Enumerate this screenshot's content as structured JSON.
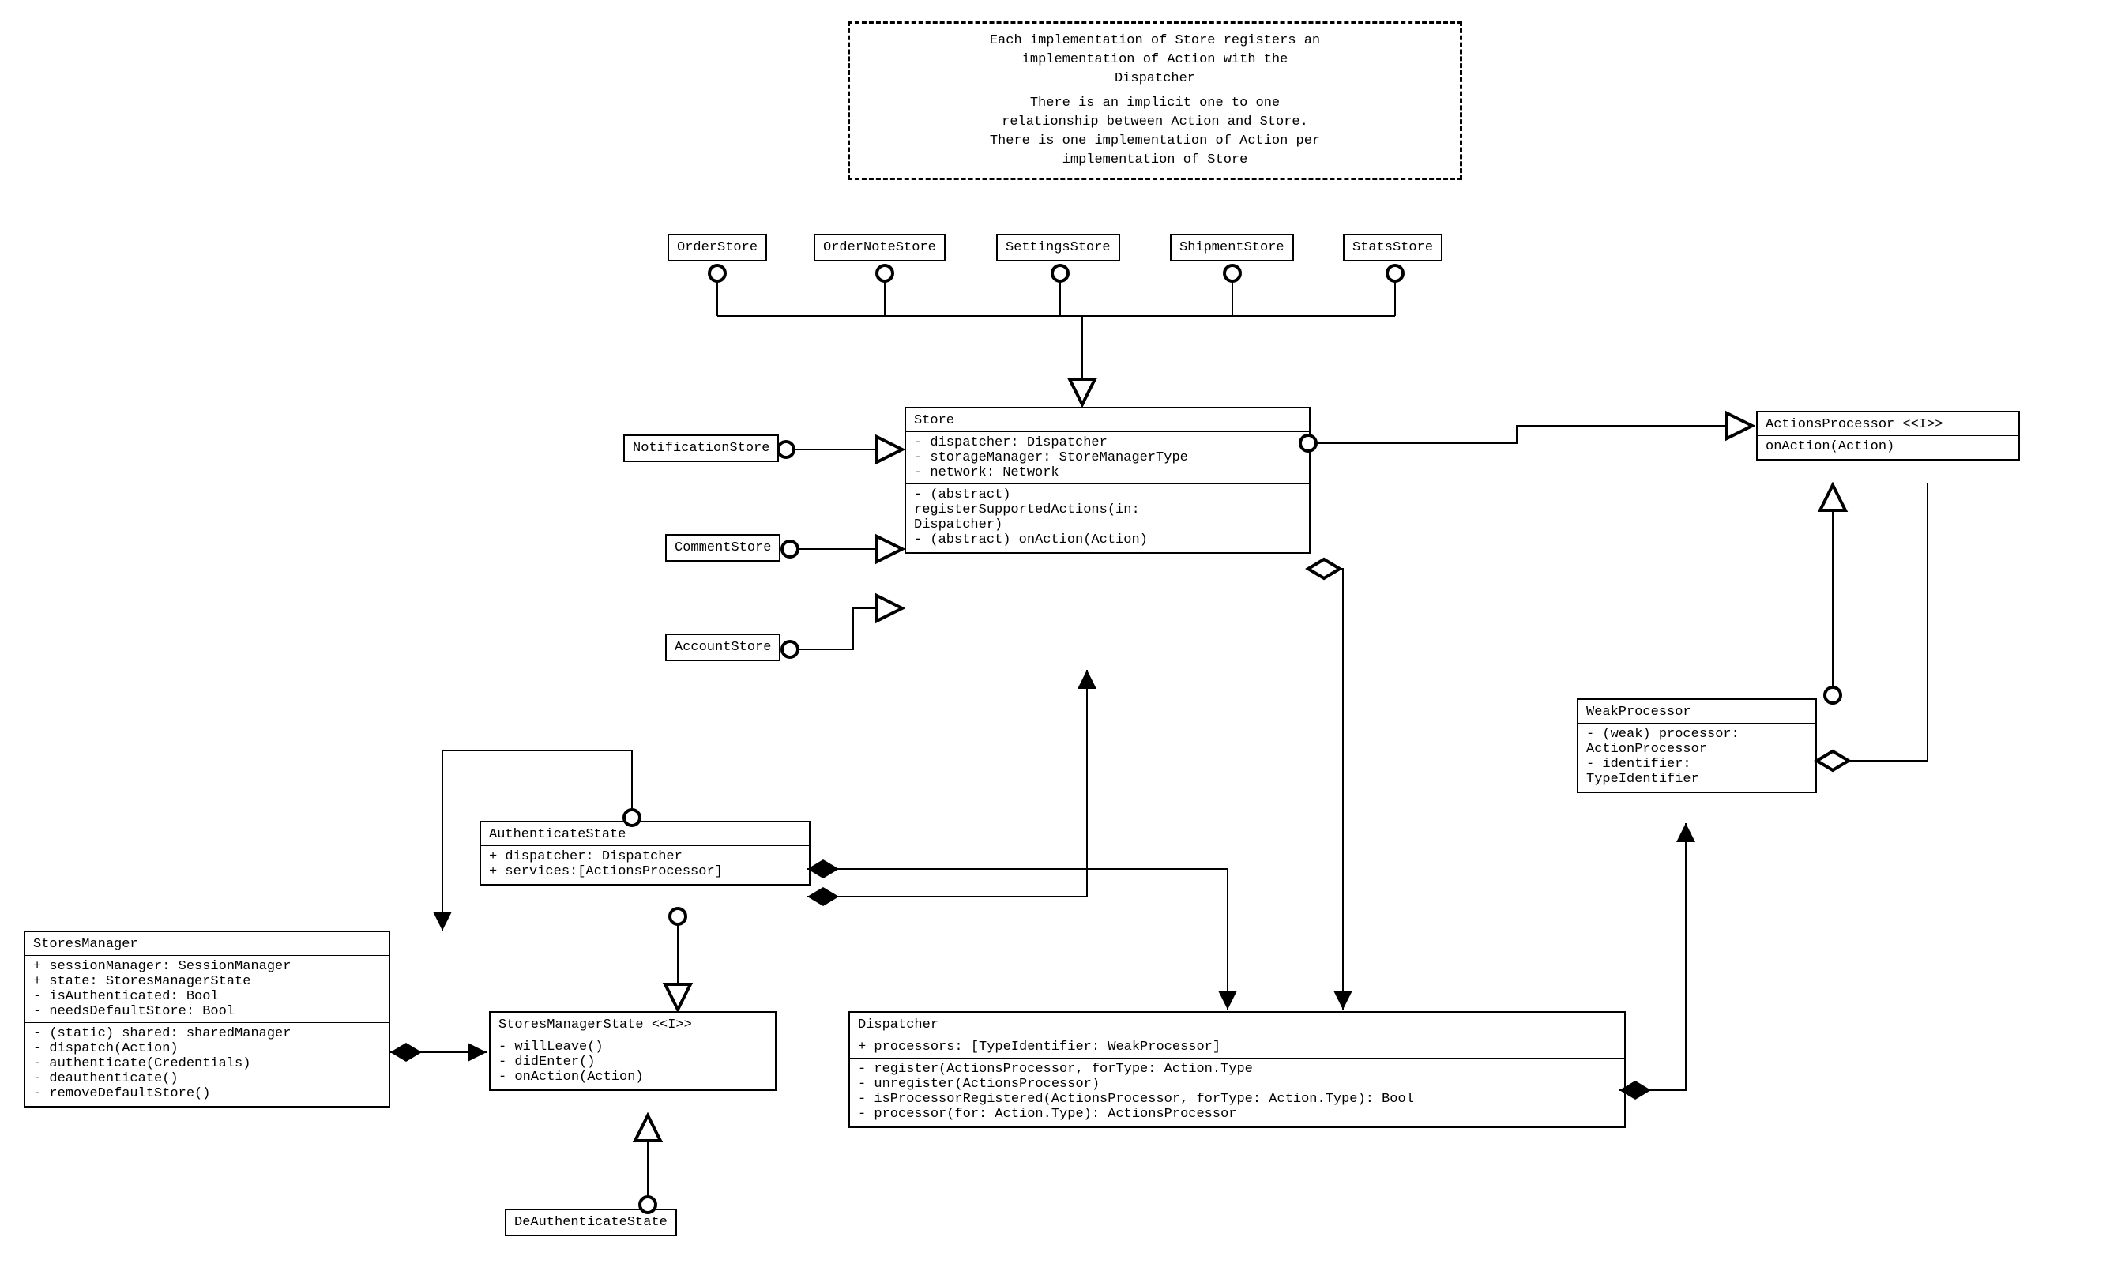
{
  "note": {
    "p1": "Each implementation of Store registers an",
    "p2": "implementation of Action with the",
    "p3": "Dispatcher",
    "p4": "There is an implicit one to one",
    "p5": "relationship between Action and Store.",
    "p6": "There is one implementation of Action per",
    "p7": "implementation of Store"
  },
  "topStores": {
    "orderStore": "OrderStore",
    "orderNoteStore": "OrderNoteStore",
    "settingsStore": "SettingsStore",
    "shipmentStore": "ShipmentStore",
    "statsStore": "StatsStore"
  },
  "leftStores": {
    "notificationStore": "NotificationStore",
    "commentStore": "CommentStore",
    "accountStore": "AccountStore"
  },
  "store": {
    "title": "Store",
    "f1": "- dispatcher: Dispatcher",
    "f2": "- storageManager: StoreManagerType",
    "f3": "- network: Network",
    "m1": "- (abstract)",
    "m2": "registerSupportedActions(in:",
    "m3": "Dispatcher)",
    "m4": "- (abstract) onAction(Action)"
  },
  "actionsProcessor": {
    "title": "ActionsProcessor <<I>>",
    "m1": "onAction(Action)"
  },
  "weakProcessor": {
    "title": "WeakProcessor",
    "f1": "- (weak) processor:",
    "f2": "ActionProcessor",
    "f3": "- identifier:",
    "f4": "TypeIdentifier"
  },
  "authState": {
    "title": "AuthenticateState",
    "f1": "+ dispatcher: Dispatcher",
    "f2": "+ services:[ActionsProcessor]"
  },
  "storesManager": {
    "title": "StoresManager",
    "f1": "+ sessionManager: SessionManager",
    "f2": "+ state: StoresManagerState",
    "f3": "- isAuthenticated: Bool",
    "f4": "- needsDefaultStore: Bool",
    "m1": "- (static) shared: sharedManager",
    "m2": "- dispatch(Action)",
    "m3": "- authenticate(Credentials)",
    "m4": "- deauthenticate()",
    "m5": "- removeDefaultStore()"
  },
  "storesManagerState": {
    "title": "StoresManagerState <<I>>",
    "m1": "- willLeave()",
    "m2": "- didEnter()",
    "m3": "- onAction(Action)"
  },
  "dispatcher": {
    "title": "Dispatcher",
    "f1": "+ processors: [TypeIdentifier: WeakProcessor]",
    "m1": "- register(ActionsProcessor, forType: Action.Type",
    "m2": "- unregister(ActionsProcessor)",
    "m3": "- isProcessorRegistered(ActionsProcessor, forType: Action.Type): Bool",
    "m4": "- processor(for: Action.Type): ActionsProcessor"
  },
  "deAuthState": {
    "title": "DeAuthenticateState"
  }
}
